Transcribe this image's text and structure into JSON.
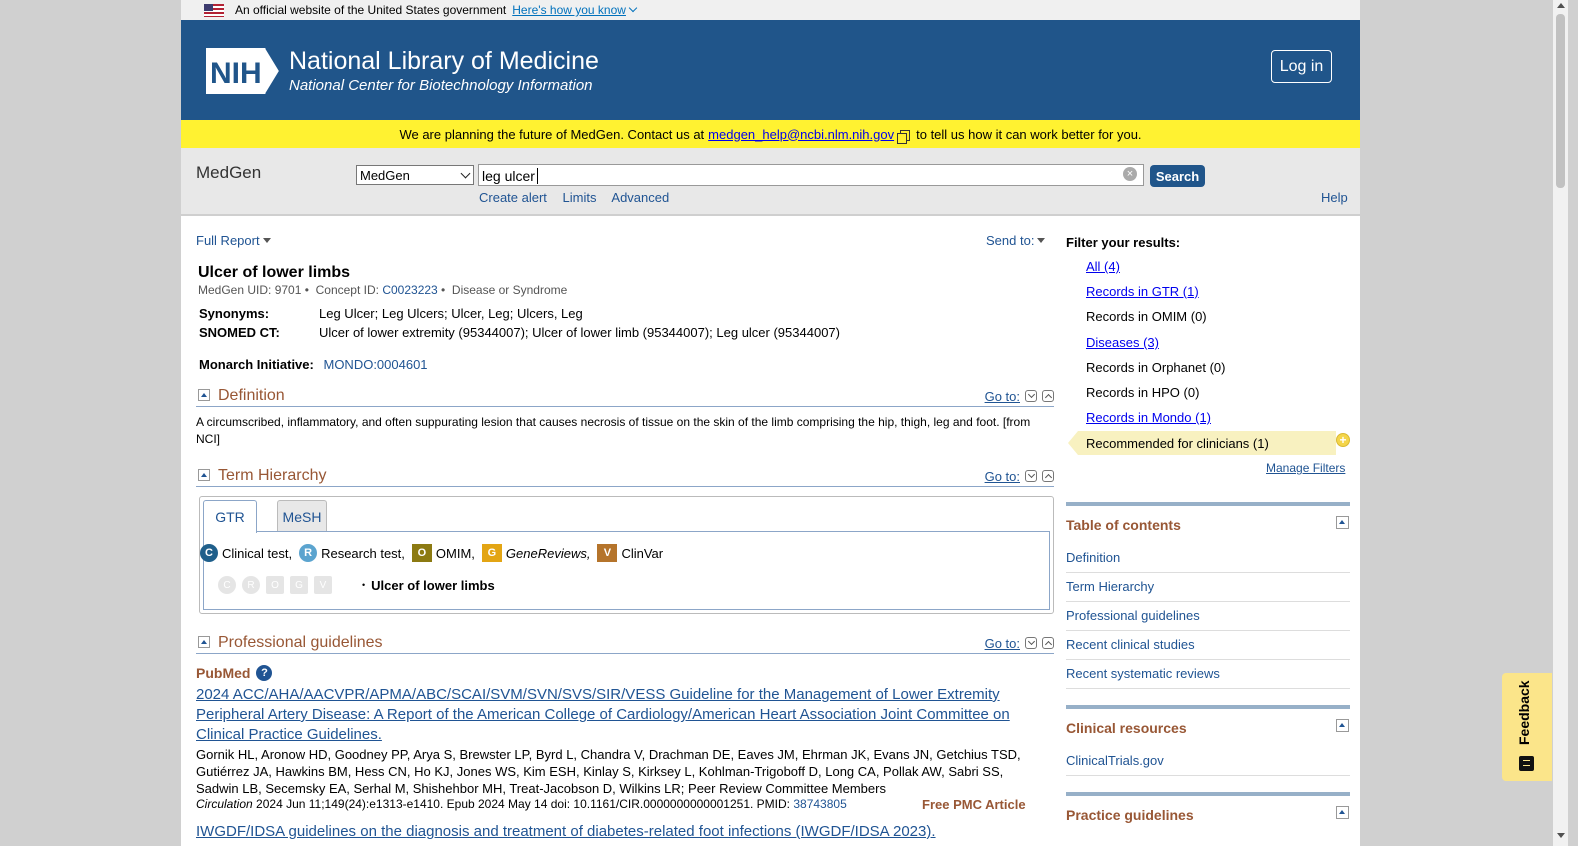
{
  "gov_banner": {
    "text": "An official website of the United States government",
    "how": "Here's how you know"
  },
  "header": {
    "title": "National Library of Medicine",
    "subtitle": "National Center for Biotechnology Information",
    "logo": "NIH",
    "login": "Log in"
  },
  "notice": {
    "before": "We are planning the future of MedGen. Contact us at",
    "email": "medgen_help@ncbi.nlm.nih.gov",
    "after": "to tell us how it can work better for you."
  },
  "search": {
    "db_name": "MedGen",
    "db_selected": "MedGen",
    "term": "leg ulcer",
    "button": "Search",
    "links": [
      "Create alert",
      "Limits",
      "Advanced"
    ],
    "help": "Help"
  },
  "report": {
    "format": "Full Report",
    "send_to": "Send to:"
  },
  "record": {
    "title": "Ulcer of lower limbs",
    "uid_label": "MedGen UID:",
    "uid": "9701",
    "concept_label": "Concept ID:",
    "concept_id": "C0023223",
    "semantic_type": "Disease or Syndrome",
    "synonyms_label": "Synonyms:",
    "synonyms": "Leg Ulcer; Leg Ulcers; Ulcer, Leg; Ulcers, Leg",
    "snomed_label": "SNOMED CT:",
    "snomed": "Ulcer of lower extremity (95344007); Ulcer of lower limb (95344007); Leg ulcer (95344007)",
    "monarch_label": "Monarch Initiative:",
    "monarch": "MONDO:0004601"
  },
  "sections": {
    "definition": {
      "title": "Definition",
      "goto": "Go to:",
      "text": "A circumscribed, inflammatory, and often suppurating lesion that causes necrosis of tissue on the skin of the limb comprising the hip, thigh, leg and foot. [from NCI]"
    },
    "hierarchy": {
      "title": "Term Hierarchy",
      "goto": "Go to:",
      "tabs": [
        "GTR",
        "MeSH"
      ],
      "legend": [
        {
          "letter": "C",
          "label": "Clinical test,",
          "color": "#1f5f8b"
        },
        {
          "letter": "R",
          "label": "Research test,",
          "color": "#5ba4cf"
        },
        {
          "letter": "O",
          "label": "OMIM,",
          "color": "#8c7a12"
        },
        {
          "letter": "G",
          "label": "GeneReviews,",
          "color": "#e3a514"
        },
        {
          "letter": "V",
          "label": "ClinVar",
          "color": "#b5742b"
        }
      ],
      "node": "Ulcer of lower limbs"
    },
    "guidelines": {
      "title": "Professional guidelines",
      "goto": "Go to:",
      "source": "PubMed",
      "ref1_title": "2024 ACC/AHA/AACVPR/APMA/ABC/SCAI/SVM/SVN/SVS/SIR/VESS Guideline for the Management of Lower Extremity Peripheral Artery Disease: A Report of the American College of Cardiology/American Heart Association Joint Committee on Clinical Practice Guidelines.",
      "ref1_authors": "Gornik HL, Aronow HD, Goodney PP, Arya S, Brewster LP, Byrd L, Chandra V, Drachman DE, Eaves JM, Ehrman JK, Evans JN, Getchius TSD, Gutiérrez JA, Hawkins BM, Hess CN, Ho KJ, Jones WS, Kim ESH, Kinlay S, Kirksey L, Kohlman-Trigoboff D, Long CA, Pollak AW, Sabri SS, Sadwin LB, Secemsky EA, Serhal M, Shishehbor MH, Treat-Jacobson D, Wilkins LR; Peer Review Committee Members",
      "ref1_journal": "Circulation",
      "ref1_cite": "2024 Jun 11;149(24):e1313-e1410. Epub 2024 May 14 doi: 10.1161/CIR.0000000000001251. PMID:",
      "ref1_pmid": "38743805",
      "ref1_free": "Free PMC Article",
      "ref2_title": "IWGDF/IDSA guidelines on the diagnosis and treatment of diabetes-related foot infections (IWGDF/IDSA 2023)."
    }
  },
  "filters": {
    "heading": "Filter your results:",
    "items": [
      {
        "label": "All (4)",
        "link": true
      },
      {
        "label": "Records in GTR (1)",
        "link": true
      },
      {
        "label": "Records in OMIM (0)",
        "link": false
      },
      {
        "label": "Diseases (3)",
        "link": true
      },
      {
        "label": "Records in Orphanet (0)",
        "link": false
      },
      {
        "label": "Records in HPO (0)",
        "link": false
      },
      {
        "label": "Records in Mondo (1)",
        "link": true
      }
    ],
    "recommended": "Recommended for clinicians (1)",
    "manage": "Manage Filters"
  },
  "toc": {
    "title": "Table of contents",
    "items": [
      "Definition",
      "Term Hierarchy",
      "Professional guidelines",
      "Recent clinical studies",
      "Recent systematic reviews"
    ]
  },
  "clinical_resources": {
    "title": "Clinical resources",
    "items": [
      "ClinicalTrials.gov"
    ]
  },
  "practice_guidelines": {
    "title": "Practice guidelines"
  },
  "feedback": {
    "label": "Feedback"
  }
}
